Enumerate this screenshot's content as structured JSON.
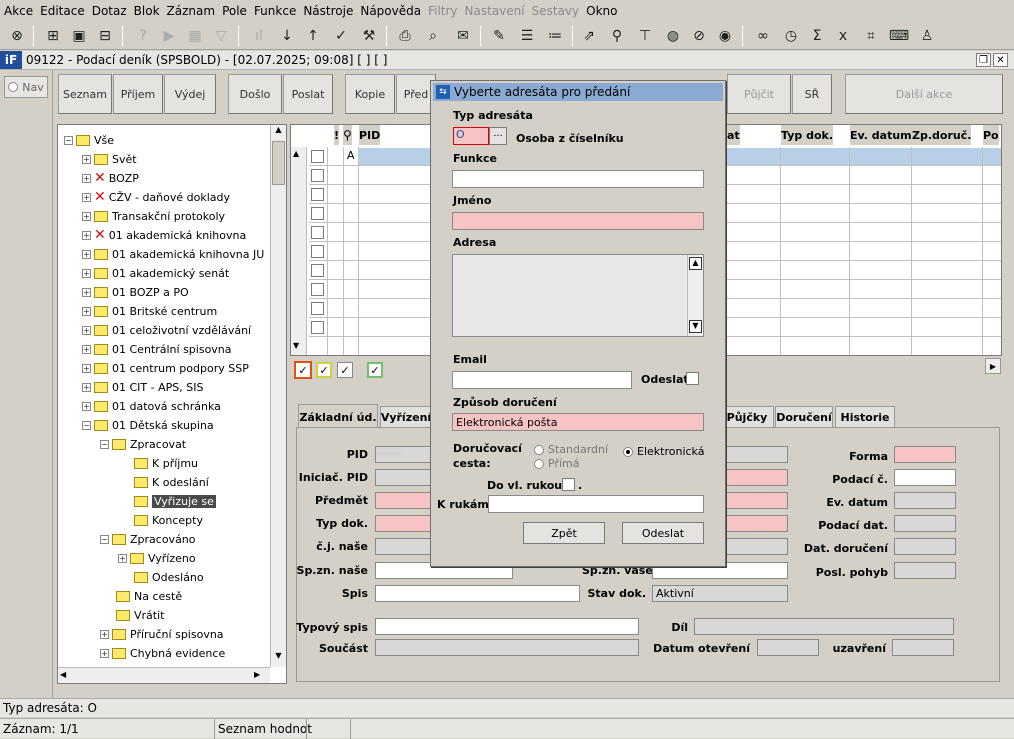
{
  "menu": [
    "Akce",
    "Editace",
    "Dotaz",
    "Blok",
    "Záznam",
    "Pole",
    "Funkce",
    "Nástroje",
    "Nápověda",
    "Filtry",
    "Nastavení",
    "Sestavy",
    "Okno"
  ],
  "menu_disabled": [
    "Filtry",
    "Nastavení",
    "Sestavy"
  ],
  "window": {
    "title": "09122 - Podací deník (SPSBOLD) - [02.07.2025; 09:08] [ ] [ ]",
    "logo": "iF"
  },
  "nav": {
    "label": "Nav"
  },
  "buttons": {
    "seznam": "Seznam",
    "prijem": "Příjem",
    "vydej": "Výdej",
    "doslo": "Došlo",
    "poslat": "Poslat",
    "kopie": "Kopie",
    "pred": "Před",
    "pujcit": "Půjčit",
    "sr": "SŘ",
    "dalsi": "Další akce"
  },
  "tree": {
    "root": "Vše",
    "items": [
      "Svět",
      "BOZP",
      "CŽV - daňové doklady",
      "Transakční protokoly",
      "01 akademická knihovna",
      "01 akademická knihovna JU",
      "01 akademický senát",
      "01 BOZP a PO",
      "01 Britské centrum",
      "01 celoživotní vzdělávání",
      "01 Centrální spisovna",
      "01 centrum podpory SSP",
      "01 CIT - APS, SIS",
      "01 datová schránka",
      "01 Dětská skupina"
    ],
    "sub": [
      "Zpracovat",
      "K příjmu",
      "K odeslání",
      "Vyřizuje se",
      "Koncepty",
      "Zpracováno",
      "Vyřízeno",
      "Odesláno",
      "Na cestě",
      "Vrátit",
      "Příruční spisovna",
      "Chybná evidence"
    ]
  },
  "grid": {
    "headers": {
      "excl": "!",
      "pid": "PID",
      "at": "at",
      "typdok": "Typ dok.",
      "evdatum": "Ev. datum",
      "zpdoruc": "Zp.doruč.",
      "po": "Po"
    },
    "first_row_mark": "A"
  },
  "tabs": [
    "Základní úd.",
    "Vyřízení",
    "Půjčky",
    "Doručení",
    "Historie"
  ],
  "form": {
    "pid": "PID",
    "inicpid": "Iniciač. PID",
    "predmet": "Předmět",
    "typdok": "Typ dok.",
    "cjnase": "č.j. naše",
    "spznnase": "Sp.zn. naše",
    "spis": "Spis",
    "spznvase": "Sp.zn. vaše",
    "stavdok": "Stav dok.",
    "stavdok_value": "Aktivní",
    "forma": "Forma",
    "podacic": "Podací č.",
    "evdatum": "Ev. datum",
    "podacidat": "Podací dat.",
    "datdoruceni": "Dat. doručení",
    "poslpohyb": "Posl. pohyb",
    "typovyspis": "Typový spis",
    "dil": "Díl",
    "soucast": "Součást",
    "datumotevreni": "Datum otevření",
    "uzavreni": "uzavření"
  },
  "dialog": {
    "title": "Vyberte adresáta pro předání",
    "typ_adresata_label": "Typ adresáta",
    "typ_adresata_value": "O",
    "osoba_label": "Osoba z číselníku",
    "funkce_label": "Funkce",
    "jmeno_label": "Jméno",
    "adresa_label": "Adresa",
    "email_label": "Email",
    "odeslat_label": "Odeslat",
    "zpusob_label": "Způsob doručení",
    "zpusob_value": "Elektronická pošta",
    "cesta_label1": "Doručovací",
    "cesta_label2": "cesta:",
    "radio_standard": "Standardní",
    "radio_elektronicka": "Elektronická",
    "radio_prima": "Přímá",
    "dovlrukou_label": "Do vl. rukou",
    "dot": ".",
    "krukam_label": "K rukám",
    "btn_zpet": "Zpět",
    "btn_odeslat": "Odeslat"
  },
  "status": {
    "hint": "Typ adresáta: O",
    "zaznam": "Záznam: 1/1",
    "seznam": "Seznam hodnot"
  }
}
